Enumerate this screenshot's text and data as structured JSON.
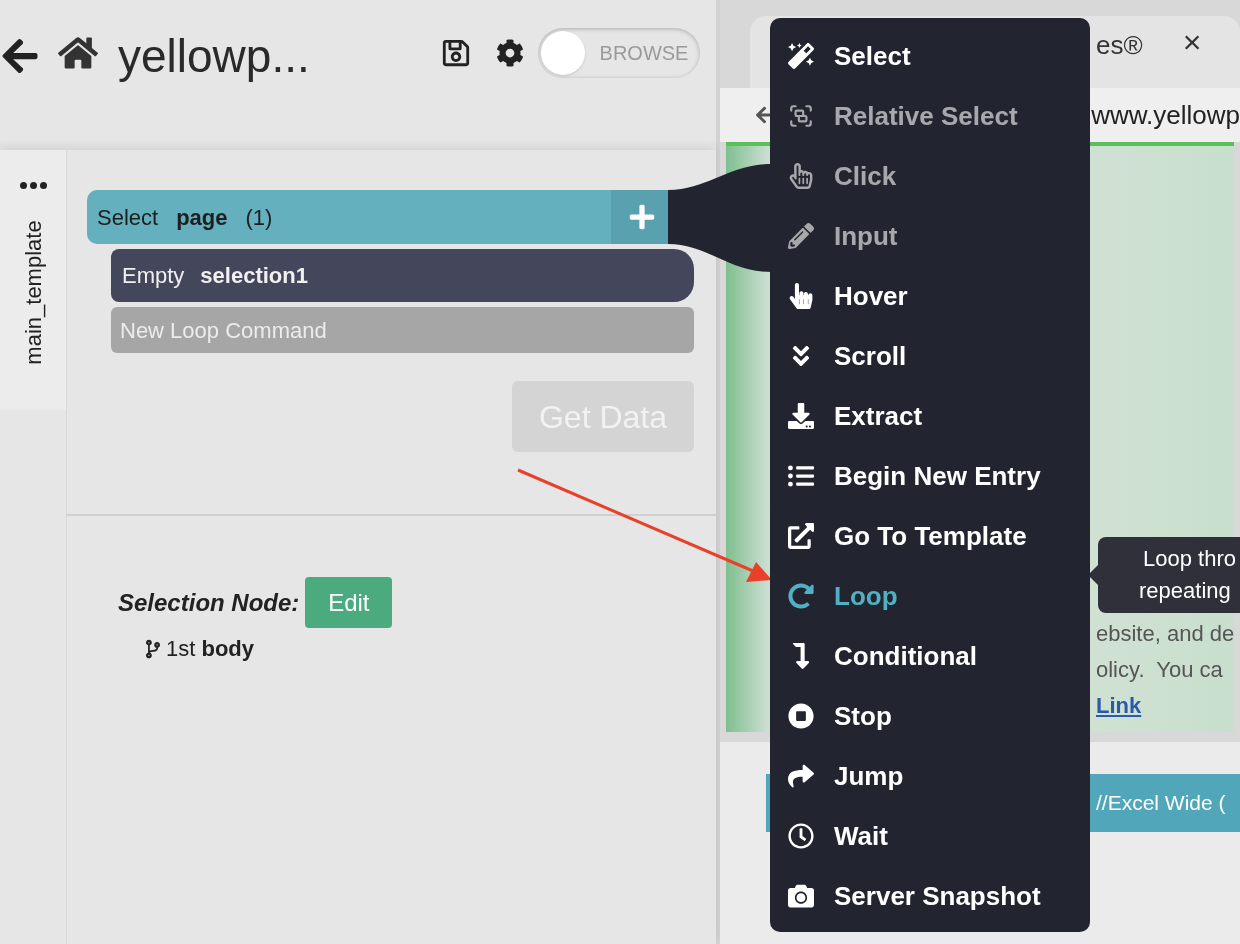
{
  "header": {
    "title": "yellowp...",
    "toggle": {
      "label": "BROWSE",
      "on": false
    }
  },
  "side_tab": {
    "label": "main_template"
  },
  "commands": [
    {
      "kind": "select",
      "verb": "Select",
      "target": "page",
      "count": "(1)"
    },
    {
      "kind": "empty",
      "verb": "Empty",
      "target": "selection1"
    },
    {
      "kind": "new",
      "label": "New Loop Command"
    }
  ],
  "get_data": {
    "label": "Get Data",
    "disabled": true
  },
  "selection_node": {
    "label": "Selection Node:",
    "button": "Edit",
    "path": "1st **body**"
  },
  "browser": {
    "tab_title": "es®",
    "close": "×",
    "address": "www.yellowp",
    "content_lines": [
      "ebsite, and de",
      "olicy.  You ca"
    ],
    "link": "Link",
    "button": "//Excel Wide ("
  },
  "menu": {
    "items": [
      {
        "label": "Select",
        "disabled": false,
        "selected": false
      },
      {
        "label": "Relative Select",
        "disabled": true,
        "selected": false
      },
      {
        "label": "Click",
        "disabled": true,
        "selected": false
      },
      {
        "label": "Input",
        "disabled": true,
        "selected": false
      },
      {
        "label": "Hover",
        "disabled": false,
        "selected": false
      },
      {
        "label": "Scroll",
        "disabled": false,
        "selected": false
      },
      {
        "label": "Extract",
        "disabled": false,
        "selected": false
      },
      {
        "label": "Begin New Entry",
        "disabled": false,
        "selected": false
      },
      {
        "label": "Go To Template",
        "disabled": false,
        "selected": false
      },
      {
        "label": "Loop",
        "disabled": false,
        "selected": true
      },
      {
        "label": "Conditional",
        "disabled": false,
        "selected": false
      },
      {
        "label": "Stop",
        "disabled": false,
        "selected": false
      },
      {
        "label": "Jump",
        "disabled": false,
        "selected": false
      },
      {
        "label": "Wait",
        "disabled": false,
        "selected": false
      },
      {
        "label": "Server Snapshot",
        "disabled": false,
        "selected": false
      }
    ]
  },
  "tooltip": {
    "lines": [
      "Loop thro",
      "repeating"
    ]
  }
}
